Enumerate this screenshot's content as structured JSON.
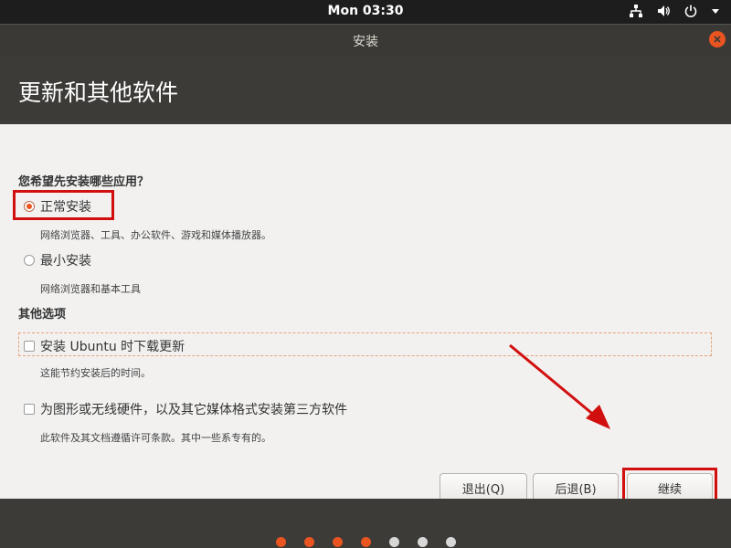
{
  "topbar": {
    "clock": "Mon 03:30",
    "icons": [
      "network-icon",
      "volume-icon",
      "power-icon",
      "menu-caret-icon"
    ]
  },
  "window": {
    "title": "安装"
  },
  "page": {
    "title": "更新和其他软件"
  },
  "install_type": {
    "heading": "您希望先安装哪些应用？",
    "options": [
      {
        "label": "正常安装",
        "description": "网络浏览器、工具、办公软件、游戏和媒体播放器。",
        "selected": true
      },
      {
        "label": "最小安装",
        "description": "网络浏览器和基本工具",
        "selected": false
      }
    ]
  },
  "other_options": {
    "heading": "其他选项",
    "items": [
      {
        "label": "安装 Ubuntu 时下载更新",
        "description": "这能节约安装后的时间。",
        "checked": false
      },
      {
        "label": "为图形或无线硬件，以及其它媒体格式安装第三方软件",
        "description": "此软件及其文档遵循许可条款。其中一些系专有的。",
        "checked": false
      }
    ]
  },
  "buttons": {
    "quit": "退出(Q)",
    "back": "后退(B)",
    "continue": "继续"
  },
  "progress": {
    "total_steps": 7,
    "completed_steps": 4,
    "active_color": "#e95420",
    "inactive_color": "#d8d8d8"
  },
  "colors": {
    "accent": "#e95420",
    "annotation_red": "#d20f0f"
  }
}
